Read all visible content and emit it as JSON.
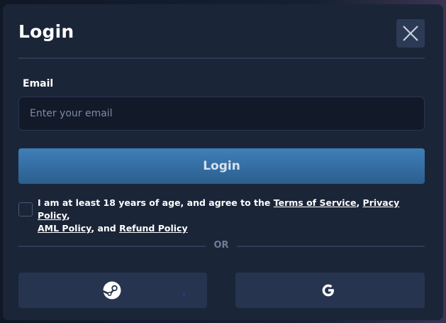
{
  "modal": {
    "title": "Login",
    "close_icon": "close-x-icon"
  },
  "email": {
    "label": "Email",
    "placeholder": "Enter your email",
    "value": ""
  },
  "login_button": {
    "label": "Login"
  },
  "terms": {
    "checked": false,
    "prefix": "I am at least 18 years of age, and agree to the ",
    "terms_link": "Terms of Service",
    "sep1": ", ",
    "privacy_link": "Privacy Policy",
    "sep2": ",",
    "aml_link": "AML Policy",
    "sep3": ", and ",
    "refund_link": "Refund Policy"
  },
  "divider": {
    "or_text": "OR"
  },
  "social": {
    "steam_icon": "steam-icon",
    "google_icon": "google-icon"
  },
  "colors": {
    "modal_bg": "#1b2538",
    "input_bg": "#121a29",
    "login_button": "#3a77ad",
    "social_button": "#26344f",
    "divider": "#2c3a58"
  }
}
